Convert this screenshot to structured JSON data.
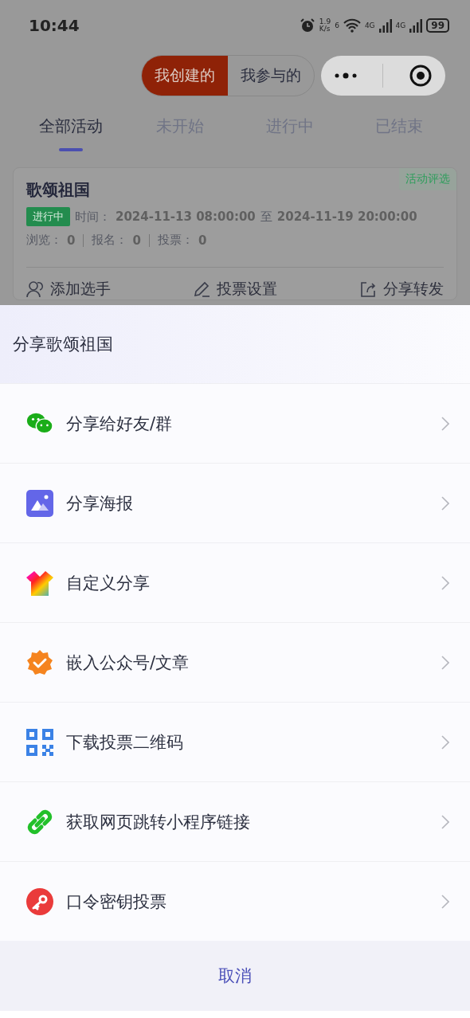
{
  "status_bar": {
    "time": "10:44",
    "net_speed": "1.9",
    "net_unit": "K/s",
    "wifi_label": "6",
    "signal_labels": [
      "4G",
      "4G"
    ],
    "battery": "99"
  },
  "segments": [
    {
      "label": "我创建的",
      "selected": true
    },
    {
      "label": "我参与的",
      "selected": false
    }
  ],
  "tabs": [
    {
      "label": "全部活动",
      "selected": true
    },
    {
      "label": "未开始",
      "selected": false
    },
    {
      "label": "进行中",
      "selected": false
    },
    {
      "label": "已结束",
      "selected": false
    }
  ],
  "card": {
    "title": "歌颂祖国",
    "tag": "活动评选",
    "status": "进行中",
    "time_label": "时间：",
    "start": "2024-11-13 08:00:00",
    "separator": "至",
    "end": "2024-11-19 20:00:00",
    "stats": [
      {
        "label": "浏览：",
        "value": "0"
      },
      {
        "label": "报名：",
        "value": "0"
      },
      {
        "label": "投票：",
        "value": "0"
      }
    ],
    "actions": [
      {
        "label": "添加选手",
        "kind": "person"
      },
      {
        "label": "投票设置",
        "kind": "pencil"
      },
      {
        "label": "分享转发",
        "kind": "share"
      }
    ]
  },
  "sheet": {
    "title": "分享歌颂祖国",
    "items": [
      {
        "label": "分享给好友/群",
        "kind": "chat"
      },
      {
        "label": "分享海报",
        "kind": "image"
      },
      {
        "label": "自定义分享",
        "kind": "shirt"
      },
      {
        "label": "嵌入公众号/文章",
        "kind": "badge"
      },
      {
        "label": "下载投票二维码",
        "kind": "qr"
      },
      {
        "label": "获取网页跳转小程序链接",
        "kind": "link"
      },
      {
        "label": "口令密钥投票",
        "kind": "key"
      }
    ],
    "cancel": "取消"
  }
}
